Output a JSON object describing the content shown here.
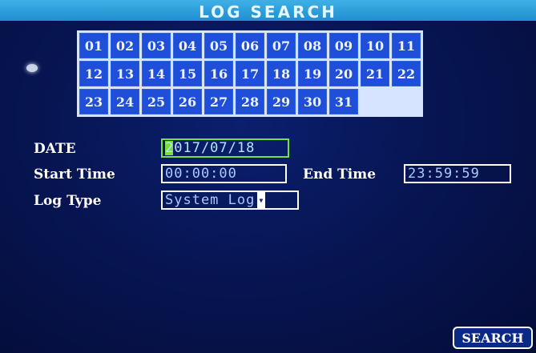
{
  "header": {
    "title": "LOG SEARCH"
  },
  "calendar": {
    "days": [
      "01",
      "02",
      "03",
      "04",
      "05",
      "06",
      "07",
      "08",
      "09",
      "10",
      "11",
      "12",
      "13",
      "14",
      "15",
      "16",
      "17",
      "18",
      "19",
      "20",
      "21",
      "22",
      "23",
      "24",
      "25",
      "26",
      "27",
      "28",
      "29",
      "30",
      "31"
    ]
  },
  "form": {
    "date_label": "DATE",
    "date_value": "2017/07/18",
    "start_label": "Start Time",
    "start_value": "00:00:00",
    "end_label": "End Time",
    "end_value": "23:59:59",
    "logtype_label": "Log Type",
    "logtype_value": "System Log"
  },
  "actions": {
    "search_label": "SEARCH"
  },
  "colors": {
    "title_bar": "#2ea3de",
    "background": "#071553",
    "day_cell": "#1f4fd8",
    "active_field_border": "#7adf3a"
  }
}
